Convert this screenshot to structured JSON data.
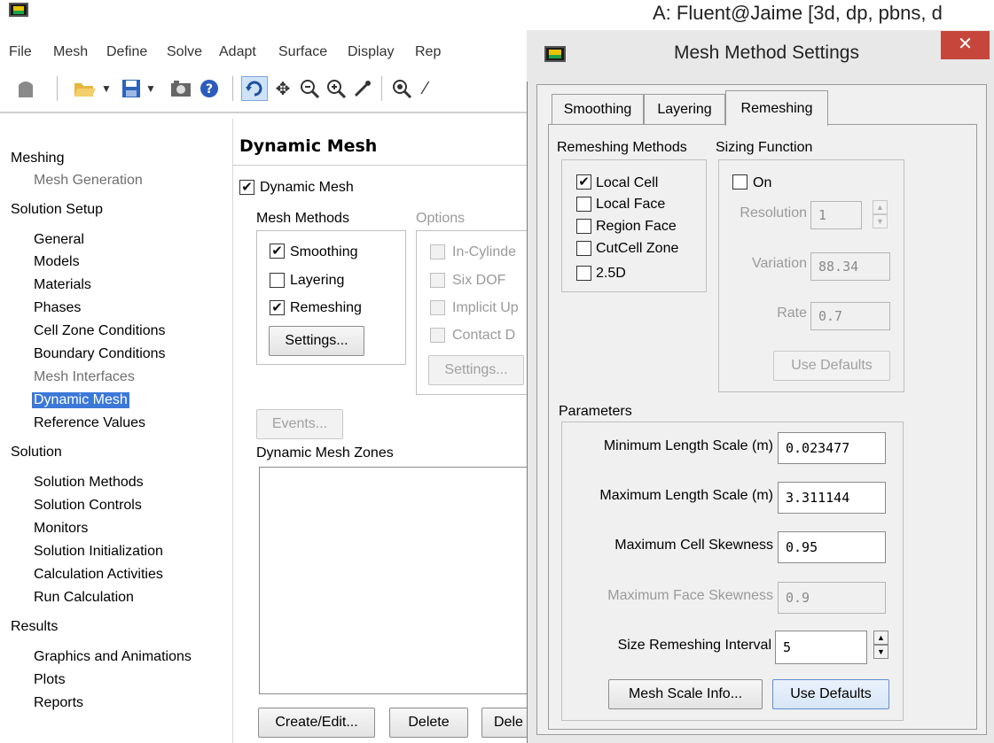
{
  "window": {
    "title": "A: Fluent@Jaime  [3d, dp, pbns, d"
  },
  "menu": [
    "File",
    "Mesh",
    "Define",
    "Solve",
    "Adapt",
    "Surface",
    "Display",
    "Rep"
  ],
  "nav": {
    "meshing": "Meshing",
    "mesh_generation": "Mesh Generation",
    "solution_setup": "Solution Setup",
    "setup_items": [
      "General",
      "Models",
      "Materials",
      "Phases",
      "Cell Zone Conditions",
      "Boundary Conditions",
      "Mesh Interfaces",
      "Dynamic Mesh",
      "Reference Values"
    ],
    "solution": "Solution",
    "solution_items": [
      "Solution Methods",
      "Solution Controls",
      "Monitors",
      "Solution Initialization",
      "Calculation Activities",
      "Run Calculation"
    ],
    "results": "Results",
    "results_items": [
      "Graphics and Animations",
      "Plots",
      "Reports"
    ]
  },
  "task": {
    "title": "Dynamic Mesh",
    "dynamic_mesh_label": "Dynamic Mesh",
    "dynamic_mesh_checked": true,
    "mesh_methods_label": "Mesh Methods",
    "options_label": "Options",
    "methods": [
      {
        "label": "Smoothing",
        "checked": true
      },
      {
        "label": "Layering",
        "checked": false
      },
      {
        "label": "Remeshing",
        "checked": true
      }
    ],
    "options": [
      "In-Cylinde",
      "Six DOF",
      "Implicit Up",
      "Contact D"
    ],
    "settings_label": "Settings...",
    "options_settings_label": "Settings...",
    "events_label": "Events...",
    "zones_label": "Dynamic Mesh Zones",
    "create_edit_label": "Create/Edit...",
    "delete_label": "Delete",
    "delete_all_label": "Dele"
  },
  "dialog": {
    "title": "Mesh Method Settings",
    "close_glyph": "✕",
    "tabs": [
      "Smoothing",
      "Layering",
      "Remeshing"
    ],
    "active_tab": "Remeshing",
    "remeshing_methods_label": "Remeshing Methods",
    "remeshing_methods": [
      {
        "label": "Local Cell",
        "checked": true
      },
      {
        "label": "Local Face",
        "checked": false
      },
      {
        "label": "Region Face",
        "checked": false
      },
      {
        "label": "CutCell Zone",
        "checked": false
      },
      {
        "label": "2.5D",
        "checked": false
      }
    ],
    "sizing_function_label": "Sizing Function",
    "sizing_on_label": "On",
    "sizing_on_checked": false,
    "resolution_label": "Resolution",
    "resolution_value": "1",
    "variation_label": "Variation",
    "variation_value": "88.34",
    "rate_label": "Rate",
    "rate_value": "0.7",
    "sizing_defaults_label": "Use Defaults",
    "parameters_label": "Parameters",
    "params": {
      "min_length_label": "Minimum Length Scale (m)",
      "min_length_value": "0.023477",
      "max_length_label": "Maximum Length Scale (m)",
      "max_length_value": "3.311144",
      "max_cell_skew_label": "Maximum Cell Skewness",
      "max_cell_skew_value": "0.95",
      "max_face_skew_label": "Maximum Face Skewness",
      "max_face_skew_value": "0.9",
      "interval_label": "Size Remeshing Interval",
      "interval_value": "5"
    },
    "mesh_scale_info_label": "Mesh Scale Info...",
    "use_defaults_label": "Use Defaults"
  },
  "check_glyph": "✔"
}
